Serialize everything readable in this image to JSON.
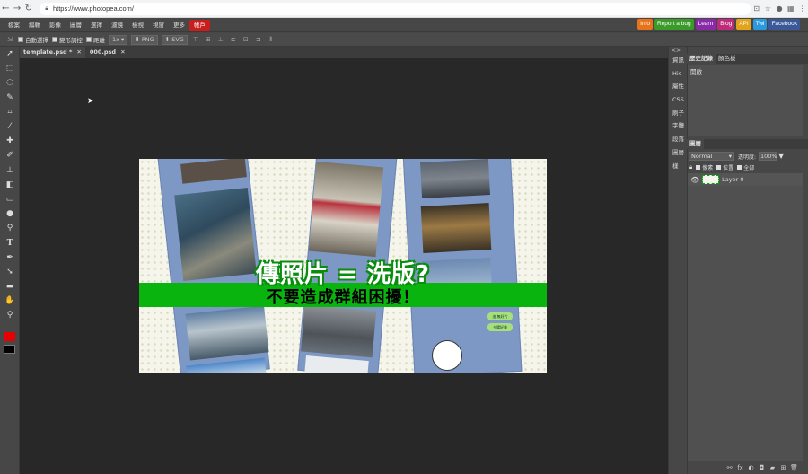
{
  "browser": {
    "url": "https://www.photopea.com/",
    "nav_icons": [
      "back-icon",
      "forward-icon",
      "reload-icon"
    ]
  },
  "menu": {
    "items": [
      "檔案",
      "編輯",
      "影像",
      "圖層",
      "選擇",
      "濾鏡",
      "檢視",
      "視窗",
      "更多"
    ],
    "account": "帳戶",
    "links": [
      {
        "label": "Info",
        "color": "#e8731a"
      },
      {
        "label": "Report a bug",
        "color": "#3a9a2a"
      },
      {
        "label": "Learn",
        "color": "#8a2aa8"
      },
      {
        "label": "Blog",
        "color": "#c02a7a"
      },
      {
        "label": "API",
        "color": "#e2a41a"
      },
      {
        "label": "Twi",
        "color": "#2a9ae0"
      },
      {
        "label": "Facebook",
        "color": "#3b5998"
      }
    ]
  },
  "options": {
    "auto_select": "自動選擇",
    "transform": "變形調控",
    "distance": "距離",
    "zoom": "1x",
    "png": "PNG",
    "svg": "SVG"
  },
  "tabs": [
    {
      "label": "template.psd *"
    },
    {
      "label": "000.psd"
    }
  ],
  "canvas": {
    "headline": "傳照片 = 洗版?",
    "subline": "不要造成群組困擾！",
    "bubble1": "這 無好片",
    "bubble2": "夕陽好美",
    "accent": "#0ab40f"
  },
  "right_icons": [
    "資訊",
    "His",
    "屬性",
    "CSS",
    "刷子",
    "字體",
    "段落",
    "圖層樣"
  ],
  "history": {
    "tabs": [
      "歷史記錄",
      "顏色板"
    ],
    "first_item": "開啟"
  },
  "layers": {
    "tab": "圖層",
    "blend_mode": "Normal",
    "opacity_label": "透明度:",
    "opacity": "100%",
    "lock_label": "鎖",
    "lock_pixels": "像素",
    "lock_position": "位置",
    "lock_all": "全部",
    "layer_name": "Layer 0"
  },
  "colors": {
    "foreground": "#e60000",
    "background": "#000000"
  }
}
